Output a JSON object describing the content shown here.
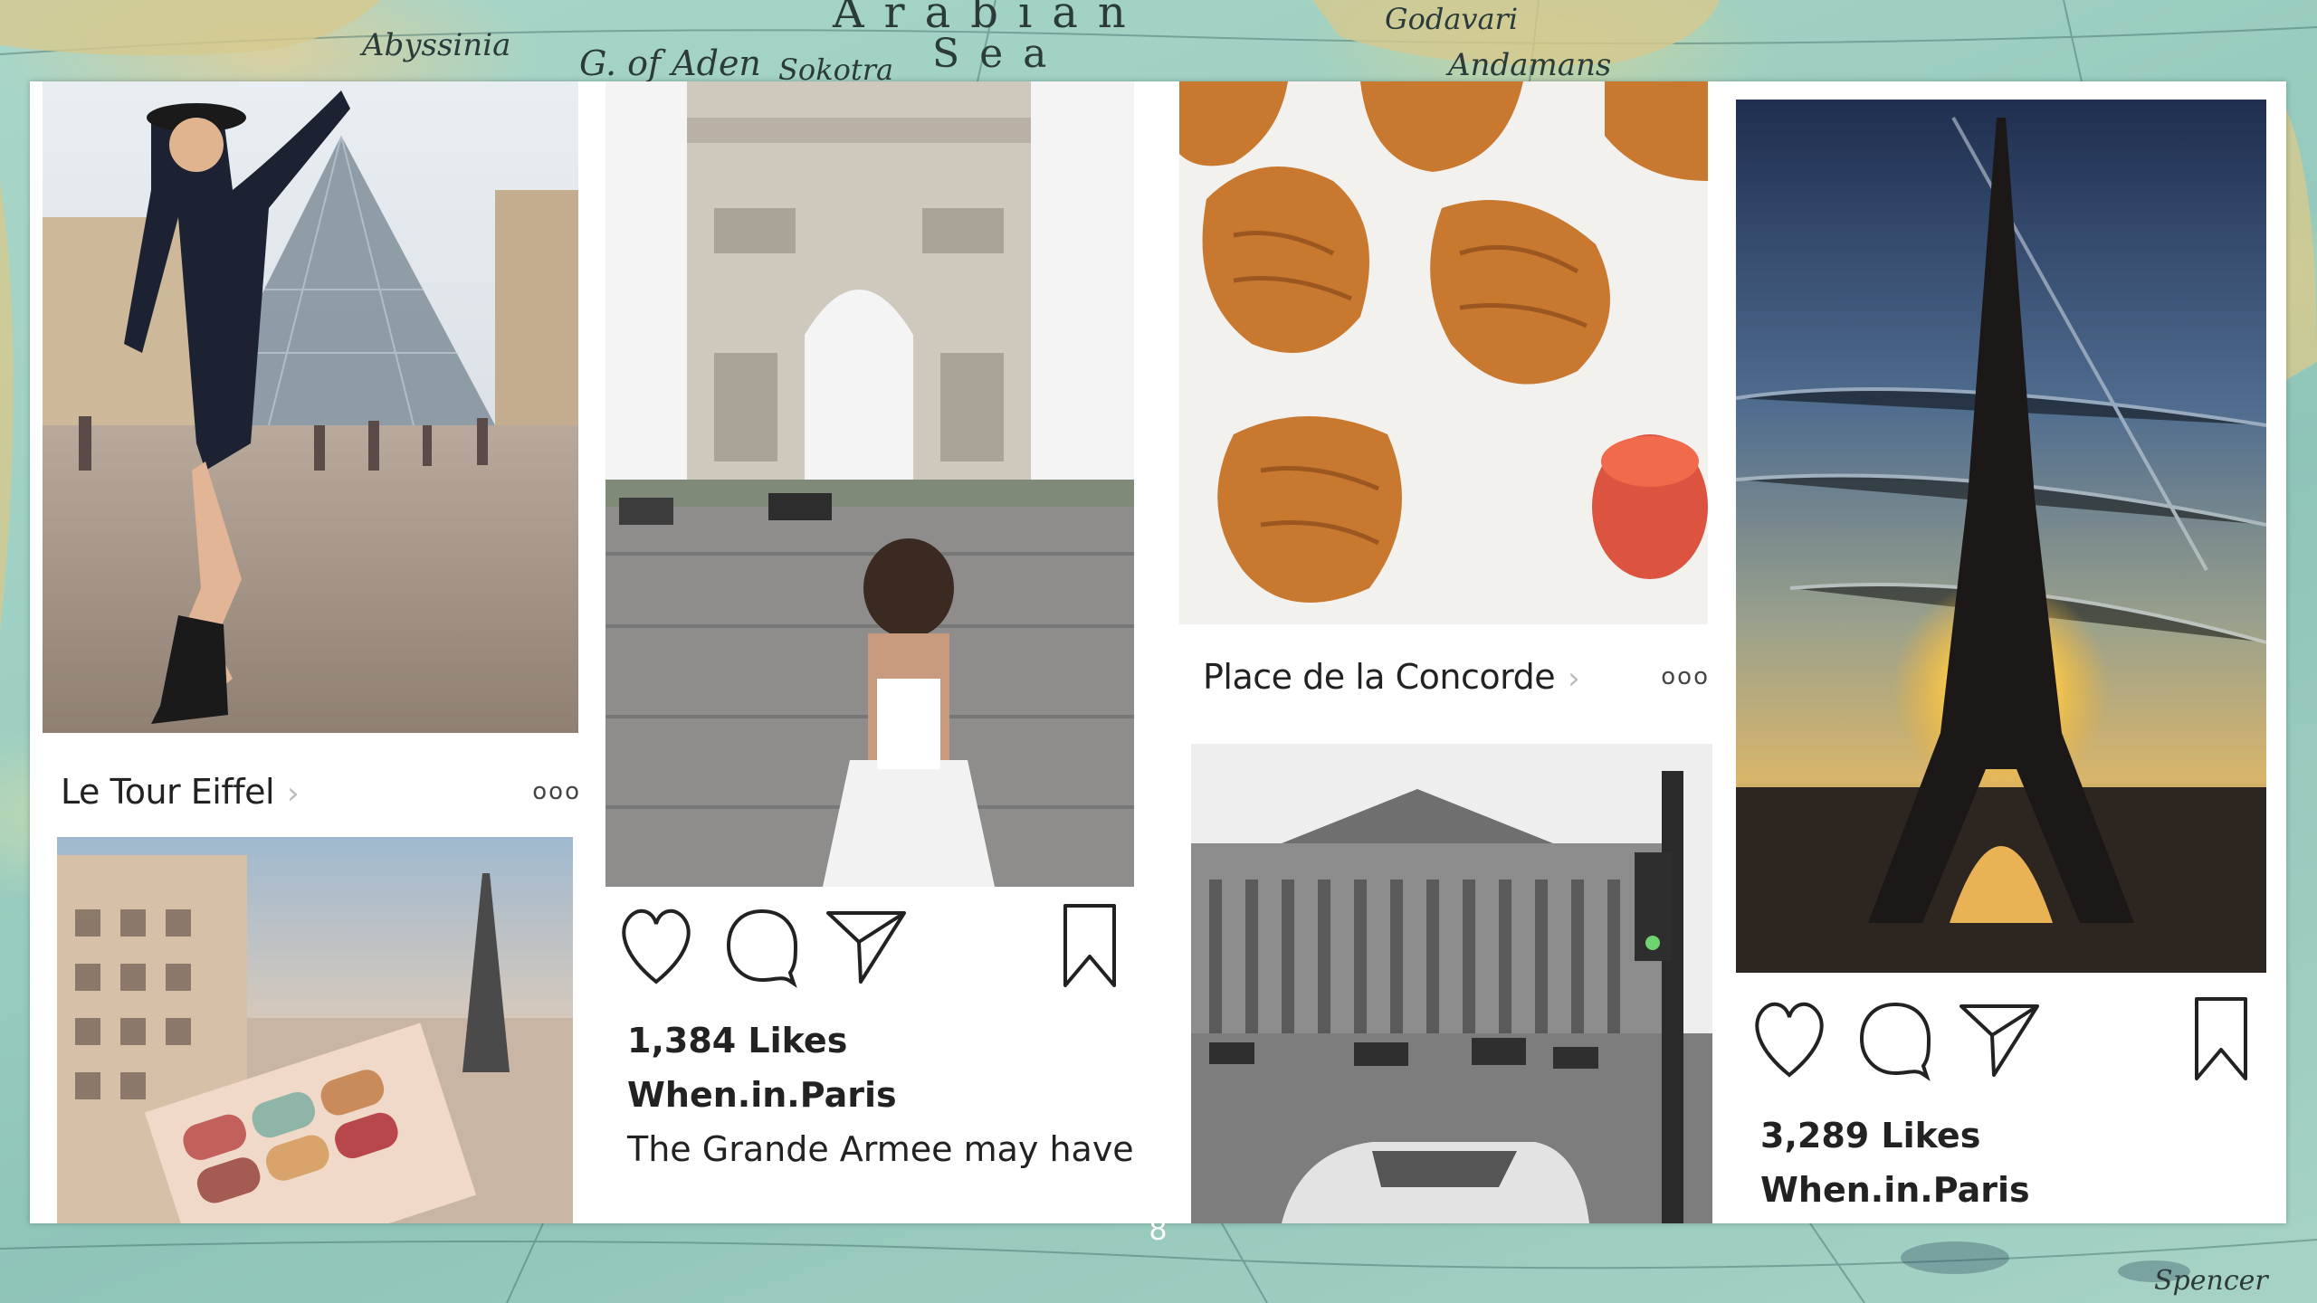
{
  "background": {
    "map_labels": [
      "Abyssinia",
      "G. of Aden",
      "Sokotra",
      "Arabian",
      "Sea",
      "Godavari",
      "Andamans",
      "Spencer"
    ]
  },
  "slide": {
    "page_number": "8",
    "posts": [
      {
        "location": "Le Tour Eiffel",
        "more_icon": "more-dots-icon"
      },
      {
        "likes": "1,384 Likes",
        "username": "When.in.Paris",
        "caption": "The Grande Armee may have"
      },
      {
        "location": "Place de la Concorde",
        "more_icon": "more-dots-icon"
      },
      {
        "likes": "3,289 Likes",
        "username": "When.in.Paris"
      }
    ],
    "icons": [
      "heart-icon",
      "comment-icon",
      "send-icon",
      "bookmark-icon"
    ]
  }
}
